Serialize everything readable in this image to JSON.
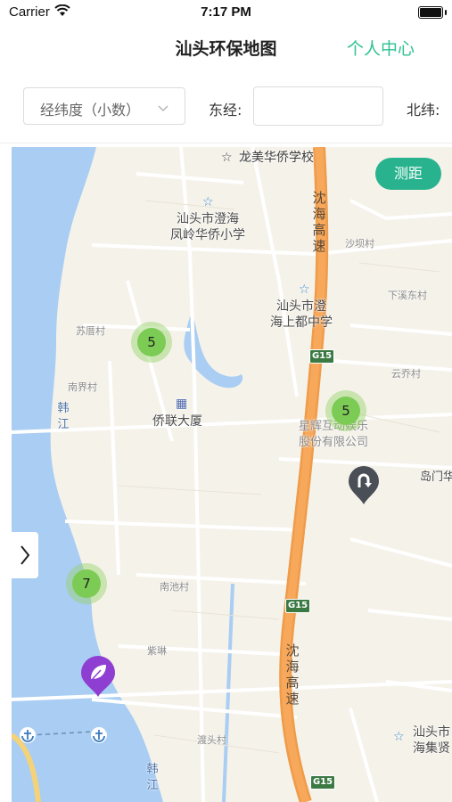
{
  "status_bar": {
    "carrier": "Carrier",
    "time": "7:17 PM"
  },
  "nav": {
    "title": "汕头环保地图",
    "right_button": "个人中心",
    "accent": "#2ec293"
  },
  "filter": {
    "coord_format": "经纬度（小数）",
    "east_label": "东经:",
    "north_label": "北纬:",
    "east_value": "",
    "north_value": ""
  },
  "map": {
    "measure_button": "测距",
    "pois": {
      "school1": "龙美华侨学校",
      "school2_line1": "汕头市澄海",
      "school2_line2": "凤岭华侨小学",
      "school3_line1": "汕头市澄",
      "school3_line2": "海上都中学",
      "building": "侨联大厦",
      "company_line1": "星辉互动娱乐",
      "company_line2": "股份有限公司",
      "v_shaba": "沙坝村",
      "v_xiaxi": "下溪东村",
      "v_yunqiao": "云乔村",
      "v_daomen": "岛门华",
      "v_suli": "苏厝村",
      "v_nanjie": "南界村",
      "v_nanchi": "南池村",
      "v_ziliu": "紫琳",
      "v_dutou": "渡头村",
      "river1": "韩江",
      "river2": "韩江",
      "bottom_right_line1": "汕头市",
      "bottom_right_line2": "海集贤",
      "highway_top": "沈海高速",
      "highway_bottom": "沈海高速",
      "shield1": "G15",
      "shield2": "G15",
      "shield3": "G15"
    },
    "clusters": [
      {
        "count": "5"
      },
      {
        "count": "5"
      },
      {
        "count": "7"
      }
    ]
  }
}
